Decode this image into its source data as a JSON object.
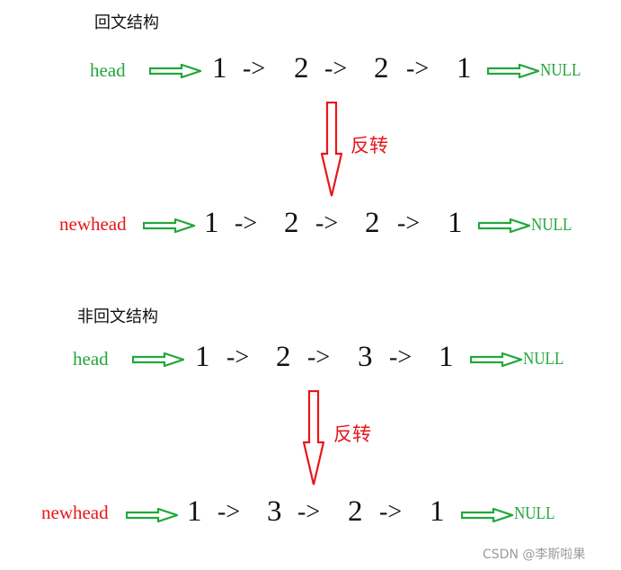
{
  "watermark": "CSDN @李斯啦果",
  "sections": [
    {
      "title": "回文结构",
      "original": {
        "head_label": "head",
        "nodes": [
          "1",
          "2",
          "2",
          "1"
        ],
        "link": "->",
        "tail": "NULL"
      },
      "reverse_label": "反转",
      "reversed": {
        "head_label": "newhead",
        "nodes": [
          "1",
          "2",
          "2",
          "1"
        ],
        "link": "->",
        "tail": "NULL"
      }
    },
    {
      "title": "非回文结构",
      "original": {
        "head_label": "head",
        "nodes": [
          "1",
          "2",
          "3",
          "1"
        ],
        "link": "->",
        "tail": "NULL"
      },
      "reverse_label": "反转",
      "reversed": {
        "head_label": "newhead",
        "nodes": [
          "1",
          "3",
          "2",
          "1"
        ],
        "link": "->",
        "tail": "NULL"
      }
    }
  ],
  "colors": {
    "head": "#22a83a",
    "newhead": "#e8161b",
    "reverse_arrow": "#e8161b",
    "pointer_arrow": "#22a83a"
  }
}
